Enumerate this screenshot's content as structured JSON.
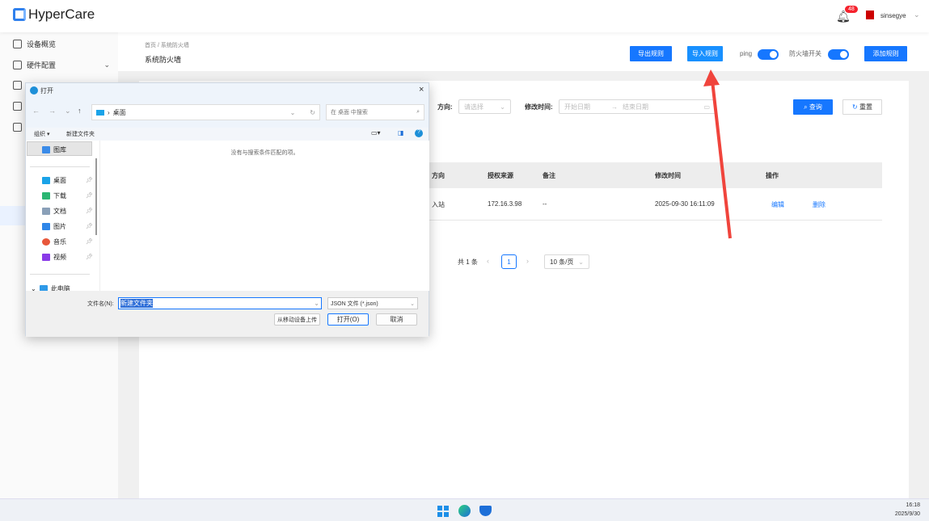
{
  "app": {
    "title": "HyperCare",
    "notification_count": "48",
    "username": "sinsegye"
  },
  "sidebar": {
    "items": [
      {
        "label": "设备概览"
      },
      {
        "label": "硬件配置"
      }
    ]
  },
  "breadcrumb": {
    "home": "首页",
    "sep": "/",
    "current": "系统防火墙"
  },
  "page_title": "系统防火墙",
  "toolbar": {
    "export": "导出规则",
    "import": "导入规则",
    "ping_label": "ping",
    "ping_on": true,
    "firewall_label": "防火墙开关",
    "firewall_on": true,
    "add": "添加规则"
  },
  "filters": {
    "direction_label": "方向:",
    "direction_placeholder": "请选择",
    "time_label": "修改时间:",
    "start_placeholder": "开始日期",
    "arrow": "→",
    "end_placeholder": "结束日期",
    "search": "查询",
    "reset": "重置"
  },
  "table": {
    "headers": [
      "方向",
      "授权来源",
      "备注",
      "修改时间",
      "操作"
    ],
    "rows": [
      {
        "direction": "入站",
        "source": "172.16.3.98",
        "note": "--",
        "time": "2025-09-30 16:11:09",
        "edit": "编辑",
        "delete": "删除"
      }
    ]
  },
  "pagination": {
    "total": "共 1 条",
    "page": "1",
    "page_size": "10 条/页"
  },
  "dialog": {
    "title": "打开",
    "path": "桌面",
    "search_placeholder": "在 桌面 中搜索",
    "organize": "组织 ▾",
    "new_folder": "新建文件夹",
    "empty_msg": "没有与搜索条件匹配的项。",
    "nav": [
      {
        "label": "图库",
        "color": "#3b8be8"
      },
      {
        "label": "桌面",
        "color": "#1aa3e8"
      },
      {
        "label": "下载",
        "color": "#2bb673"
      },
      {
        "label": "文档",
        "color": "#8aa0b8"
      },
      {
        "label": "图片",
        "color": "#2f86e8"
      },
      {
        "label": "音乐",
        "color": "#e8573b"
      },
      {
        "label": "视频",
        "color": "#8a3be8"
      },
      {
        "label": "此电脑",
        "color": "#2f9ae8"
      }
    ],
    "filename_label": "文件名(N):",
    "filename": "新建文件夹",
    "filetype": "JSON 文件 (*.json)",
    "upload": "从移动设备上传",
    "open": "打开(O)",
    "cancel": "取消"
  },
  "taskbar": {
    "time": "16:18",
    "date": "2025/9/30"
  },
  "colors": {
    "primary": "#1677ff",
    "arrow": "#f0443c"
  }
}
